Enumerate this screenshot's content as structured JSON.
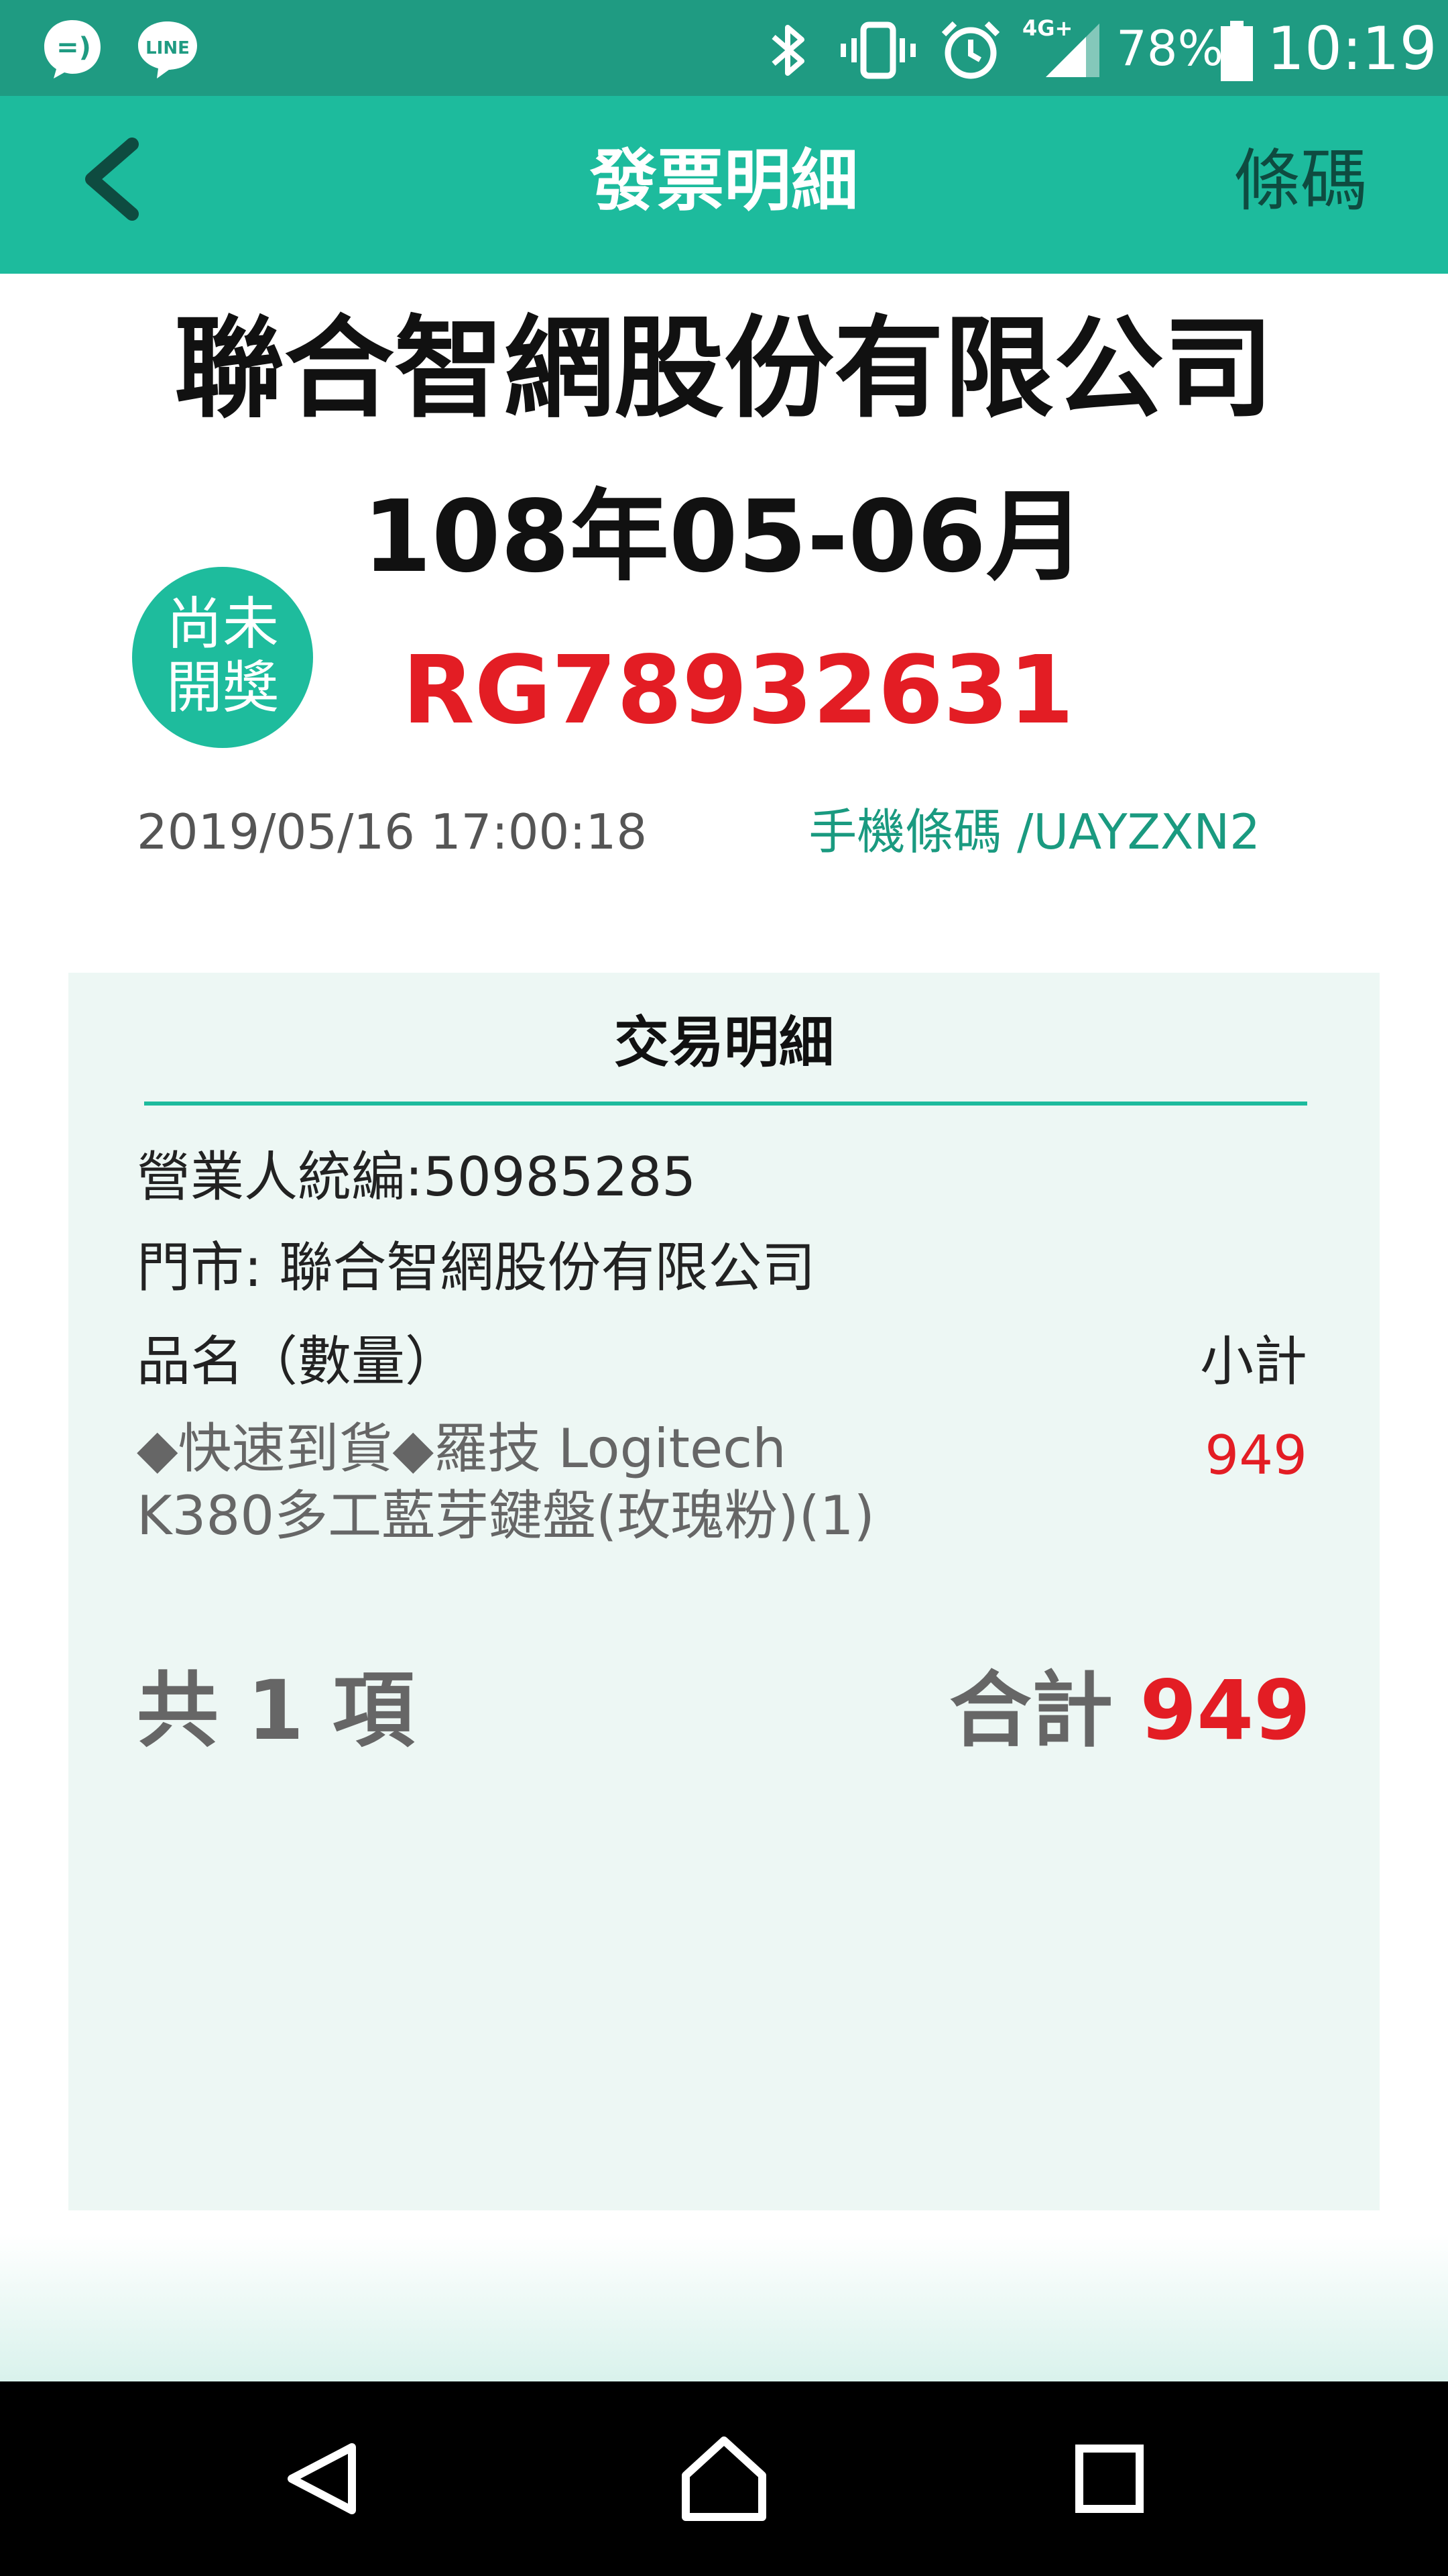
{
  "status_bar": {
    "battery_percent": "78%",
    "time": "10:19",
    "network": "4G+",
    "icons": [
      "chat-app-icon",
      "line-app-icon",
      "bluetooth-icon",
      "vibrate-icon",
      "alarm-icon",
      "signal-icon",
      "battery-icon"
    ],
    "line_label": "LINE"
  },
  "header": {
    "title": "發票明細",
    "barcode_label": "條碼",
    "back_icon": "chevron-left-icon"
  },
  "invoice": {
    "company": "聯合智網股份有限公司",
    "period": "108年05-06月",
    "lottery_status_line1": "尚未",
    "lottery_status_line2": "開獎",
    "number": "RG78932631",
    "datetime": "2019/05/16 17:00:18",
    "carrier": "手機條碼 /UAYZXN2"
  },
  "detail": {
    "title": "交易明細",
    "seller_id": "營業人統編:50985285",
    "store": "門市:  聯合智網股份有限公司",
    "col_item": "品名（數量）",
    "col_subtotal": "小計",
    "items": [
      {
        "name_line1": "◆快速到貨◆羅技 Logitech",
        "name_line2": "K380多工藍芽鍵盤(玫瑰粉)(1)",
        "price": "949"
      }
    ],
    "count_label": "共 1 項",
    "total_label": "合計",
    "total_amount": "949"
  },
  "colors": {
    "status_bar": "#1f9b82",
    "header": "#1dbb9d",
    "accent_red": "#e31d24",
    "panel_bg": "#edf7f4"
  },
  "nav": {
    "back": "nav-back-icon",
    "home": "nav-home-icon",
    "recents": "nav-recents-icon"
  }
}
